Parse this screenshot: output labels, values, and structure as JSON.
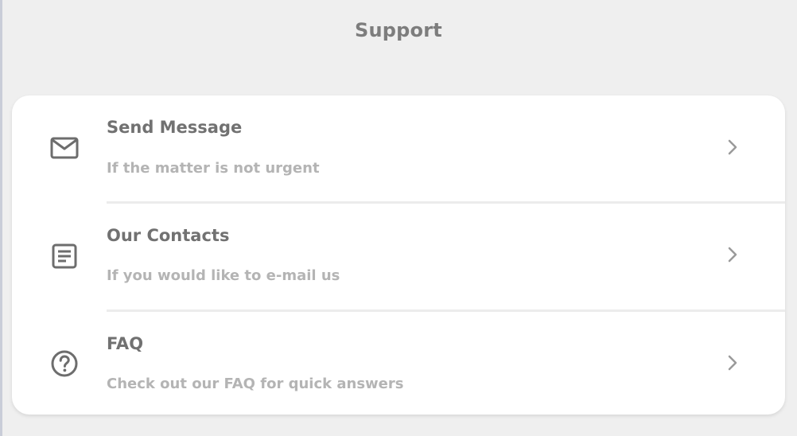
{
  "header": {
    "title": "Support"
  },
  "menu": {
    "items": [
      {
        "id": "send-message",
        "icon": "mail-icon",
        "title": "Send Message",
        "subtitle": "If the matter is not urgent"
      },
      {
        "id": "our-contacts",
        "icon": "document-list-icon",
        "title": "Our Contacts",
        "subtitle": "If you would like to e-mail us"
      },
      {
        "id": "faq",
        "icon": "help-circle-icon",
        "title": "FAQ",
        "subtitle": "Check out our FAQ for quick answers"
      }
    ]
  },
  "colors": {
    "background": "#efefef",
    "card": "#ffffff",
    "title_text": "#717171",
    "subtitle_text": "#b4b4b4",
    "icon": "#6d6d6d",
    "chevron": "#9a9a9a",
    "divider": "#ececec"
  }
}
